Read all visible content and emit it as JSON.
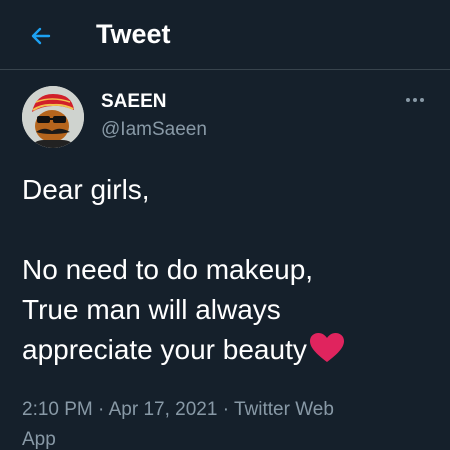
{
  "header": {
    "title": "Tweet",
    "back_icon": "arrow-left-icon",
    "accent": "#1da1f2"
  },
  "tweet": {
    "author": {
      "name": "SAEEN",
      "handle": "@IamSaeen",
      "avatar_icon": "cartoon-man-with-red-turban-avatar"
    },
    "more_icon": "more-horizontal-icon",
    "text_lines": [
      "Dear girls,",
      "",
      "No need to do makeup,",
      "True man will always",
      "appreciate your beauty"
    ],
    "emoji": "red-heart-icon",
    "time": "2:10 PM",
    "date": "Apr 17, 2021",
    "source_line1": "Twitter Web",
    "source_line2": "App",
    "separator": "·"
  },
  "colors": {
    "background": "#15202b",
    "secondary_text": "#8899a6",
    "divider": "#38444d",
    "heart": "#e0245e"
  }
}
